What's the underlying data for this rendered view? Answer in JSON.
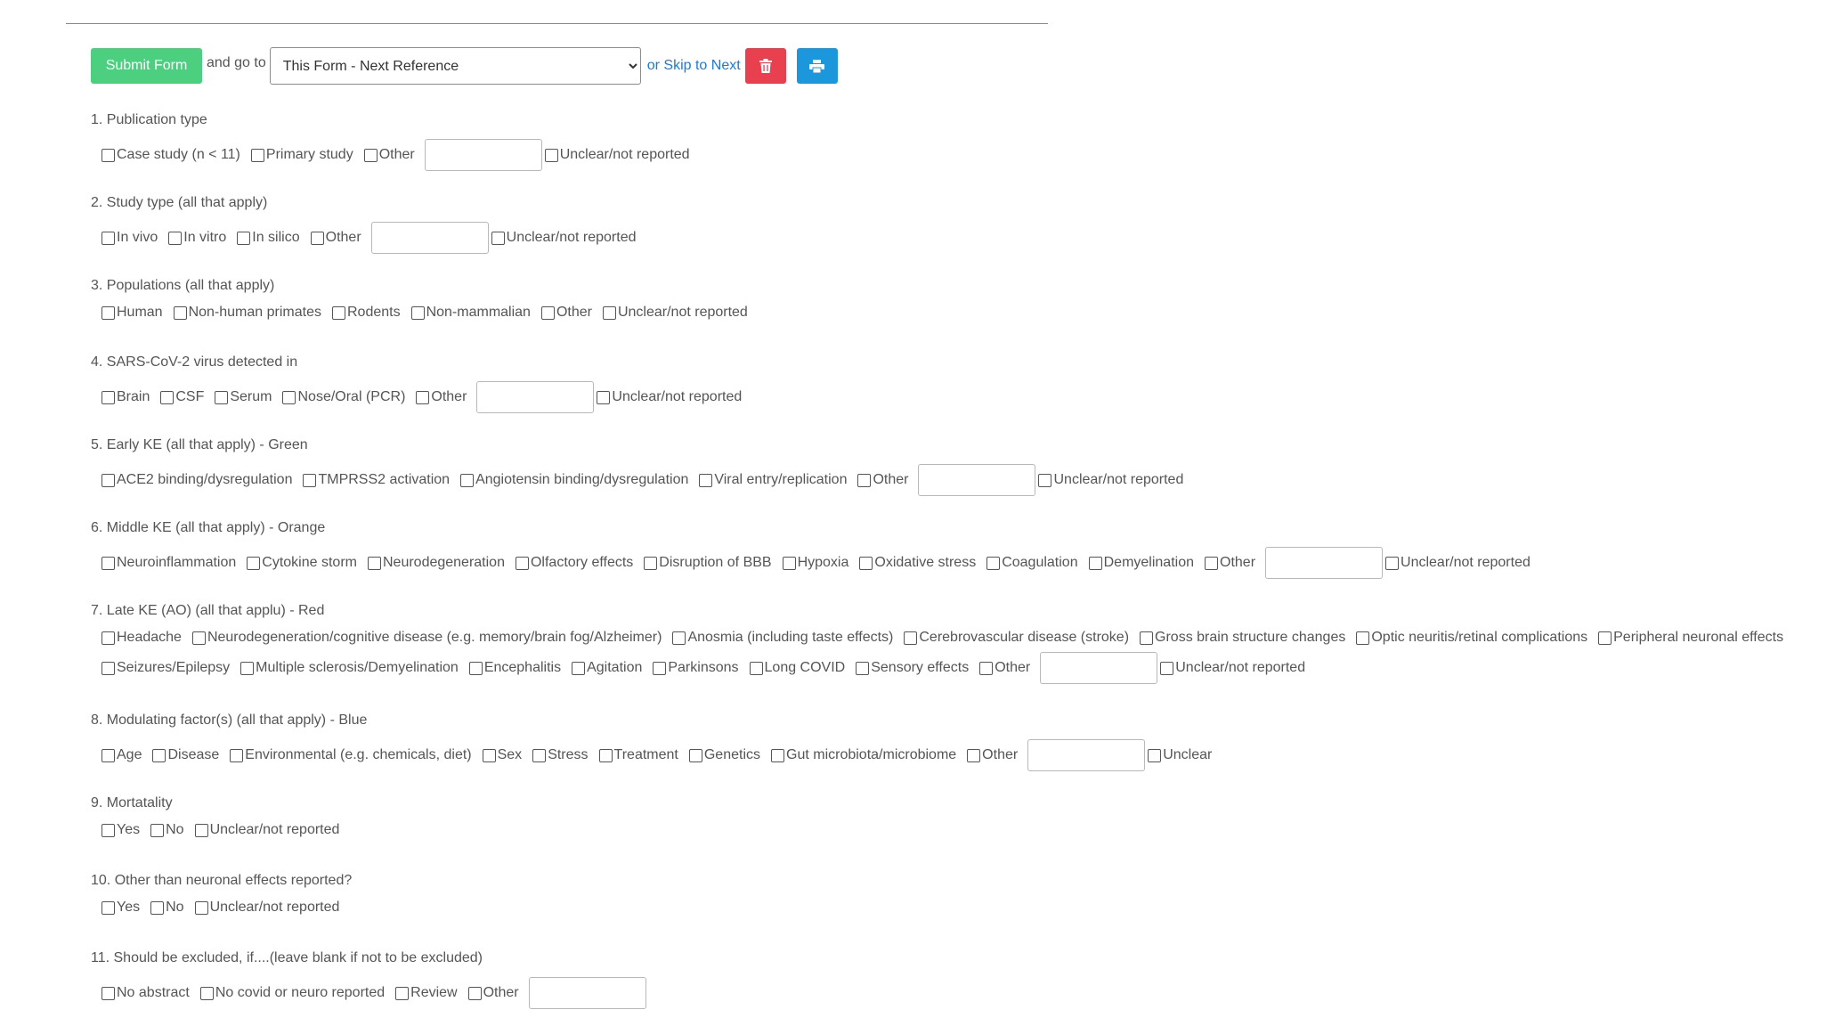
{
  "toolbar": {
    "submit_label": "Submit Form",
    "goto_label": "and go to",
    "goto_selected": "This Form - Next Reference",
    "skip_label": "or Skip to Next",
    "delete_icon": "trash-icon",
    "print_icon": "print-icon",
    "colors": {
      "submit": "#4ccf7e",
      "delete": "#e8404f",
      "print": "#1c97dc",
      "link": "#1a7bd6"
    }
  },
  "questions": [
    {
      "title": "1. Publication type",
      "options": [
        "Case study (n < 11)",
        "Primary study",
        "Other",
        "Unclear/not reported"
      ]
    },
    {
      "title": "2. Study type (all that apply)",
      "options": [
        "In vivo",
        "In vitro",
        "In silico",
        "Other",
        "Unclear/not reported"
      ]
    },
    {
      "title": "3. Populations (all that apply)",
      "options": [
        "Human",
        "Non-human primates",
        "Rodents",
        "Non-mammalian",
        "Other",
        "Unclear/not reported"
      ]
    },
    {
      "title": "4. SARS-CoV-2 virus detected in",
      "options": [
        "Brain",
        "CSF",
        "Serum",
        "Nose/Oral (PCR)",
        "Other",
        "Unclear/not reported"
      ]
    },
    {
      "title": "5. Early KE (all that apply) - Green",
      "options": [
        "ACE2 binding/dysregulation",
        "TMPRSS2 activation",
        "Angiotensin binding/dysregulation",
        "Viral entry/replication",
        "Other",
        "Unclear/not reported"
      ]
    },
    {
      "title": "6. Middle KE (all that apply) - Orange",
      "options": [
        "Neuroinflammation",
        "Cytokine storm",
        "Neurodegeneration",
        "Olfactory effects",
        "Disruption of BBB",
        "Hypoxia",
        "Oxidative stress",
        "Coagulation",
        "Demyelination",
        "Other",
        "Unclear/not reported"
      ]
    },
    {
      "title": "7. Late KE (AO) (all that applu) - Red",
      "options": [
        "Headache",
        "Neurodegeneration/cognitive disease (e.g. memory/brain fog/Alzheimer)",
        "Anosmia (including taste effects)",
        "Cerebrovascular disease (stroke)",
        "Gross brain structure changes",
        "Optic neuritis/retinal complications",
        "Peripheral neuronal effects"
      ],
      "options_row2": [
        "Seizures/Epilepsy",
        "Multiple sclerosis/Demyelination",
        "Encephalitis",
        "Agitation",
        "Parkinsons",
        "Long COVID",
        "Sensory effects",
        "Other",
        "Unclear/not reported"
      ]
    },
    {
      "title": "8. Modulating factor(s) (all that apply) - Blue",
      "options": [
        "Age",
        "Disease",
        "Environmental (e.g. chemicals, diet)",
        "Sex",
        "Stress",
        "Treatment",
        "Genetics",
        "Gut microbiota/microbiome",
        "Other",
        "Unclear"
      ]
    },
    {
      "title": "9. Mortatality",
      "options": [
        "Yes",
        "No",
        "Unclear/not reported"
      ]
    },
    {
      "title": "10. Other than neuronal effects reported?",
      "options": [
        "Yes",
        "No",
        "Unclear/not reported"
      ]
    },
    {
      "title": "11. Should be excluded, if....(leave blank if not to be excluded)",
      "options": [
        "No abstract",
        "No covid or neuro reported",
        "Review",
        "Other"
      ]
    }
  ]
}
